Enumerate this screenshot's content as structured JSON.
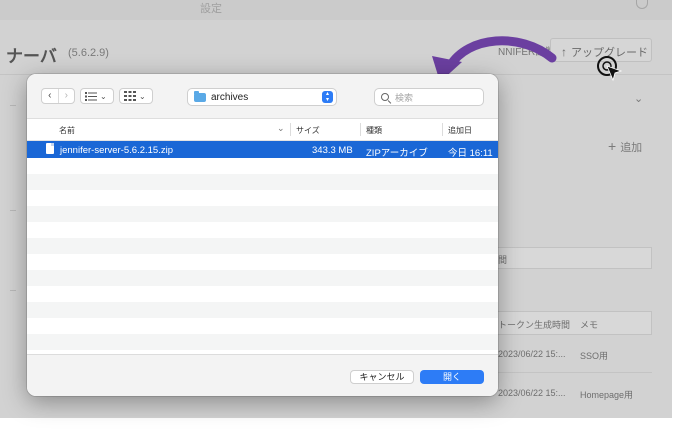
{
  "background": {
    "top_label": "設定",
    "title": "ナーバ",
    "version": "(5.6.2.9)",
    "diagnostics_label": "NNIFER診断",
    "upgrade_label": "アップグレード",
    "add_label": "追加",
    "search_box_label": "間",
    "table": {
      "headers": [
        "トークン生成時間",
        "メモ"
      ],
      "rows": [
        {
          "time": "2023/06/22 15:...",
          "memo": "SSO用"
        },
        {
          "time": "2023/06/22 15:...",
          "memo": "Homepage用"
        }
      ]
    }
  },
  "dialog": {
    "location": "archives",
    "search_placeholder": "検索",
    "columns": {
      "name": "名前",
      "size": "サイズ",
      "kind": "種類",
      "date_added": "追加日"
    },
    "files": [
      {
        "name": "jennifer-server-5.6.2.15.zip",
        "size": "343.3 MB",
        "kind": "ZIPアーカイブ",
        "date_added": "今日 16:11",
        "selected": true
      }
    ],
    "cancel_label": "キャンセル",
    "open_label": "開く"
  },
  "colors": {
    "accent": "#2d7cf6",
    "selection": "#1a67d6",
    "arrow": "#6b3fa0"
  }
}
